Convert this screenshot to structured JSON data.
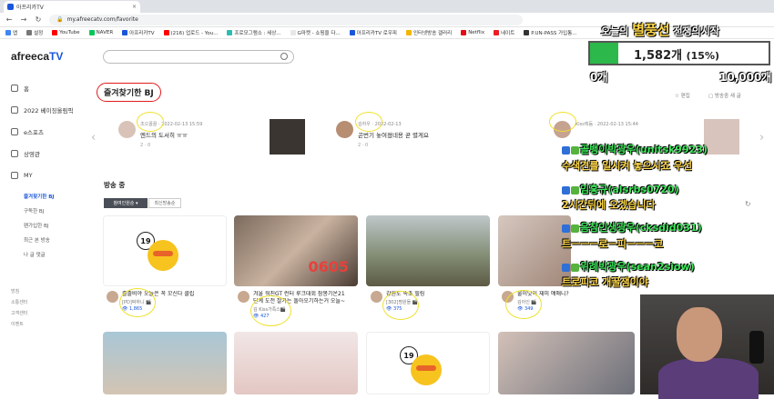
{
  "browser": {
    "tab_title": "아프리카TV",
    "url": "my.afreecatv.com/favorite",
    "bookmarks": [
      "앱",
      "설정",
      "YouTube",
      "NAVER",
      "아프리카TV",
      "(216) 업로드 - You...",
      "프로모그램소 : 세상...",
      "G마켓 - 쇼핑을 다...",
      "아프리카TV 로우피",
      "인터넷방송 갤러리",
      "Netflix",
      "네이트",
      "P.UN-PASS 가입통..."
    ]
  },
  "header": {
    "logo_text": "afreeca",
    "logo_tv": "TV"
  },
  "sidebar": {
    "items": [
      {
        "label": "홈",
        "icon": "home-icon"
      },
      {
        "label": "2022 베이징올림픽",
        "icon": "olympic-icon"
      },
      {
        "label": "e스포츠",
        "icon": "esports-icon"
      },
      {
        "label": "상영관",
        "icon": "theater-icon"
      },
      {
        "label": "MY",
        "icon": "my-icon"
      }
    ],
    "sub": [
      "즐겨찾기한 BJ",
      "구독한 BJ",
      "팬가입한 BJ",
      "최근 본 방송",
      "나 글 댓글"
    ],
    "footer": [
      "방침",
      "소통센터",
      "고객센터",
      "이벤트"
    ]
  },
  "page": {
    "title": "즐겨찾기한 BJ",
    "tool_edit": "편집",
    "tool_sort": "방송중 새 글",
    "favorites": [
      {
        "name": "조으꿀꿀",
        "time": "2022-02-13 15:59",
        "title": "엔드의 도서히 ㅠㅠ",
        "stats": "2 · 0"
      },
      {
        "name": "김하우",
        "time": "2022-02-13",
        "title": "곤번기 놓여졌네용 곧 렬게요",
        "stats": "2 · 0"
      },
      {
        "name": "Kiss랙듐",
        "time": "2022-02-13 15:44",
        "title": "",
        "stats": ""
      }
    ],
    "live_heading": "방송 중",
    "sort_active": "참여인원순 ▾",
    "sort_other": "최신방송순",
    "broadcasts": [
      {
        "title": "졸졸비야 오늘은 꼭 꼬신다 클립",
        "name": "[PD]박하니 🎬",
        "viewers": "1,865"
      },
      {
        "title": "겨울 워친GT 런터 루크대회 참봉기온21",
        "title2": "단계 도전 잘가는 돌아오기하는거 오늘~",
        "name": "김 Kiss가족스🎬",
        "viewers": "427"
      },
      {
        "title": "강원도 속초 힐링",
        "name": "[302]명원들 🎬",
        "viewers": "375"
      },
      {
        "title": "불이낫이 재미 얘매니?",
        "name": "김아인 🎬",
        "viewers": "349"
      }
    ]
  },
  "overlay": {
    "title_pre": "오늘의 ",
    "title_big": "별풍선",
    "title_post": " 전쟁의시작",
    "gauge_value": "1,582개",
    "gauge_pct": "(15%)",
    "gauge_fraction": 0.158,
    "gauge_min": "0개",
    "gauge_max": "10,000개",
    "chats": [
      {
        "who": "골뱅이박광우(unitsk9923)",
        "msg": "수색견를 일시켜 놓으시죠 우선"
      },
      {
        "who": "임홍규(alsrbs0720)",
        "msg": "2시간뒤에 오겠습니다"
      },
      {
        "who": "음참인생광우(cksdid031)",
        "msg": "트ㅡㅡㅡ로ㅡ피ㅡㅡㅡ코"
      },
      {
        "who": "위례박광우(sean2siow)",
        "msg": "트로피코 개꿀잼이야"
      }
    ]
  },
  "colors": {
    "accent": "#1a56db",
    "highlight_red": "#e21b1b",
    "circle_yellow": "#f0e02a",
    "chat_green": "#3de65a",
    "chat_yellow": "#ffd84a"
  }
}
